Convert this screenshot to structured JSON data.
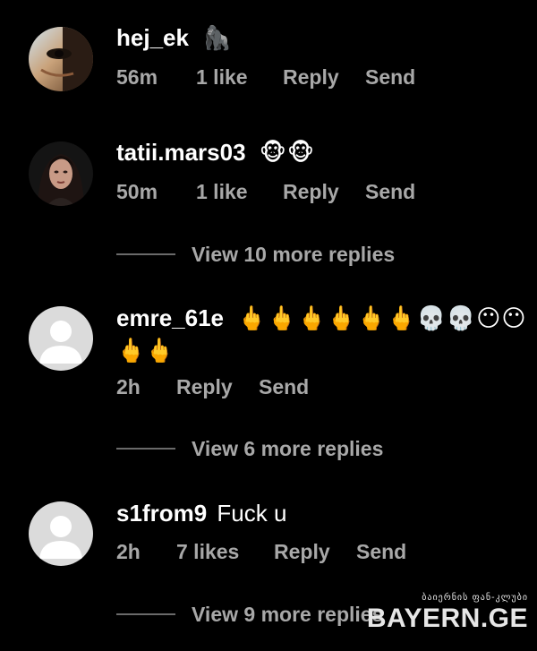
{
  "comments": [
    {
      "username": "hej_ek",
      "text": "🦍",
      "time": "56m",
      "likes": "1 like",
      "reply_label": "Reply",
      "send_label": "Send"
    },
    {
      "username": "tatii.mars03",
      "text": "🐵🐵",
      "time": "50m",
      "likes": "1 like",
      "reply_label": "Reply",
      "send_label": "Send",
      "view_replies": "View 10 more replies"
    },
    {
      "username": "emre_61e",
      "text": "🖕🖕🖕🖕🖕🖕💀💀😶😶",
      "text_line2": "🖕🖕",
      "time": "2h",
      "reply_label": "Reply",
      "send_label": "Send",
      "view_replies": "View 6 more replies"
    },
    {
      "username": "s1from9",
      "text": "Fuck u",
      "time": "2h",
      "likes": "7 likes",
      "reply_label": "Reply",
      "send_label": "Send",
      "view_replies": "View 9 more replies"
    }
  ],
  "watermark": {
    "top_text": "ბაიერნის ფან-კლუბი",
    "main_text": "BAYERN.GE"
  },
  "colors": {
    "background": "#000000",
    "text": "#ffffff",
    "secondary_text": "#a8a8a8"
  }
}
